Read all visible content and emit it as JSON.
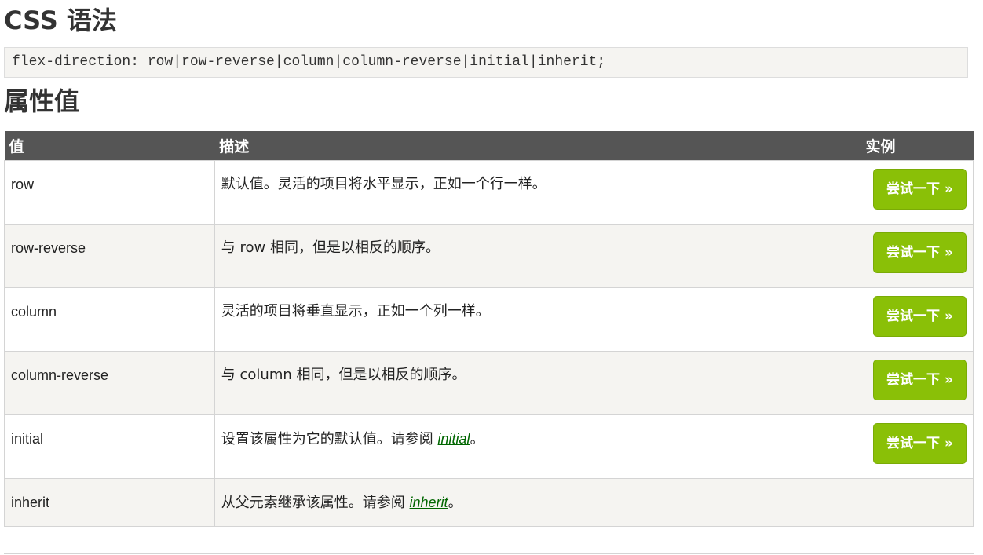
{
  "syntax_heading": "CSS 语法",
  "syntax_code": "flex-direction: row|row-reverse|column|column-reverse|initial|inherit;",
  "values_heading": "属性值",
  "table": {
    "headers": [
      "值",
      "描述",
      "实例"
    ],
    "rows": [
      {
        "value": "row",
        "desc": "默认值。灵活的项目将水平显示，正如一个行一样。",
        "button": "尝试一下 »"
      },
      {
        "value": "row-reverse",
        "desc": "与 row 相同，但是以相反的顺序。",
        "button": "尝试一下 »"
      },
      {
        "value": "column",
        "desc": "灵活的项目将垂直显示，正如一个列一样。",
        "button": "尝试一下 »"
      },
      {
        "value": "column-reverse",
        "desc": "与 column 相同，但是以相反的顺序。",
        "button": "尝试一下 »"
      },
      {
        "value": "initial",
        "desc_prefix": "设置该属性为它的默认值。请参阅 ",
        "link": "initial",
        "desc_suffix": "。",
        "button": "尝试一下 »"
      },
      {
        "value": "inherit",
        "desc_prefix": "从父元素继承该属性。请参阅 ",
        "link": "inherit",
        "desc_suffix": "。"
      }
    ]
  },
  "colors": {
    "header_bg": "#555555",
    "button_bg": "#8ac007",
    "link": "#006600",
    "stripe": "#f5f4f1"
  }
}
